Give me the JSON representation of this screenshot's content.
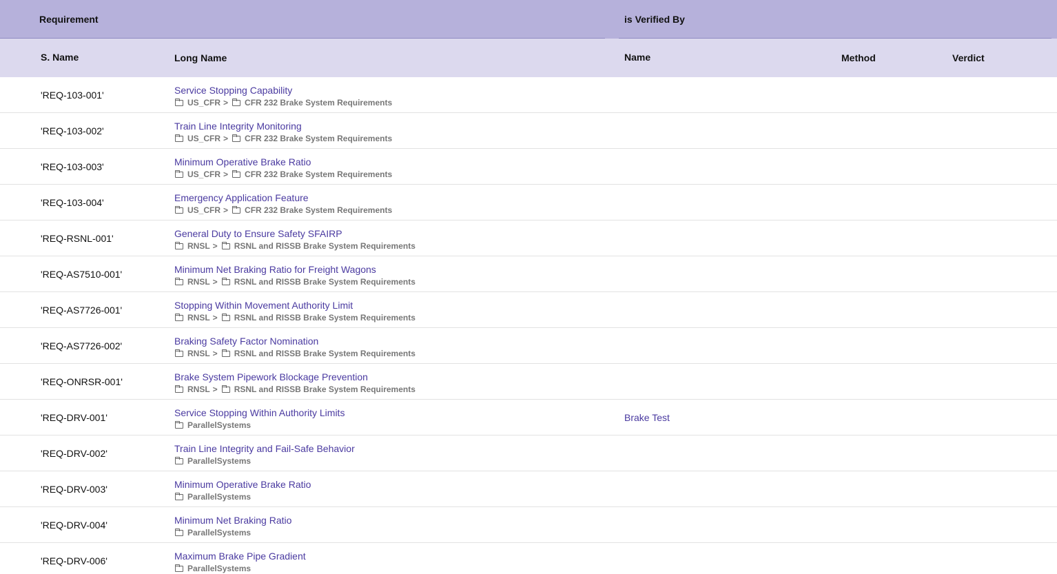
{
  "group_headers": {
    "requirement": "Requirement",
    "verified_by": "is Verified By"
  },
  "columns": {
    "s_name": "S. Name",
    "long_name": "Long Name",
    "name": "Name",
    "method": "Method",
    "verdict": "Verdict"
  },
  "separator": ">",
  "rows": [
    {
      "s_name": "'REQ-103-001'",
      "long_name": "Service Stopping Capability",
      "path": [
        "US_CFR",
        "CFR 232 Brake System Requirements"
      ],
      "verified_by": ""
    },
    {
      "s_name": "'REQ-103-002'",
      "long_name": "Train Line Integrity Monitoring",
      "path": [
        "US_CFR",
        "CFR 232 Brake System Requirements"
      ],
      "verified_by": ""
    },
    {
      "s_name": "'REQ-103-003'",
      "long_name": "Minimum Operative Brake Ratio",
      "path": [
        "US_CFR",
        "CFR 232 Brake System Requirements"
      ],
      "verified_by": ""
    },
    {
      "s_name": "'REQ-103-004'",
      "long_name": "Emergency Application Feature",
      "path": [
        "US_CFR",
        "CFR 232 Brake System Requirements"
      ],
      "verified_by": ""
    },
    {
      "s_name": "'REQ-RSNL-001'",
      "long_name": "General Duty to Ensure Safety SFAIRP",
      "path": [
        "RNSL",
        "RSNL and RISSB Brake System Requirements"
      ],
      "verified_by": ""
    },
    {
      "s_name": "'REQ-AS7510-001'",
      "long_name": "Minimum Net Braking Ratio for Freight Wagons",
      "path": [
        "RNSL",
        "RSNL and RISSB Brake System Requirements"
      ],
      "verified_by": ""
    },
    {
      "s_name": "'REQ-AS7726-001'",
      "long_name": "Stopping Within Movement Authority Limit",
      "path": [
        "RNSL",
        "RSNL and RISSB Brake System Requirements"
      ],
      "verified_by": ""
    },
    {
      "s_name": "'REQ-AS7726-002'",
      "long_name": "Braking Safety Factor Nomination",
      "path": [
        "RNSL",
        "RSNL and RISSB Brake System Requirements"
      ],
      "verified_by": ""
    },
    {
      "s_name": "'REQ-ONRSR-001'",
      "long_name": "Brake System Pipework Blockage Prevention",
      "path": [
        "RNSL",
        "RSNL and RISSB Brake System Requirements"
      ],
      "verified_by": ""
    },
    {
      "s_name": "'REQ-DRV-001'",
      "long_name": "Service Stopping Within Authority Limits",
      "path": [
        "ParallelSystems"
      ],
      "verified_by": "Brake Test"
    },
    {
      "s_name": "'REQ-DRV-002'",
      "long_name": "Train Line Integrity and Fail-Safe Behavior",
      "path": [
        "ParallelSystems"
      ],
      "verified_by": ""
    },
    {
      "s_name": "'REQ-DRV-003'",
      "long_name": "Minimum Operative Brake Ratio",
      "path": [
        "ParallelSystems"
      ],
      "verified_by": ""
    },
    {
      "s_name": "'REQ-DRV-004'",
      "long_name": "Minimum Net Braking Ratio",
      "path": [
        "ParallelSystems"
      ],
      "verified_by": ""
    },
    {
      "s_name": "'REQ-DRV-006'",
      "long_name": "Maximum Brake Pipe Gradient",
      "path": [
        "ParallelSystems"
      ],
      "verified_by": ""
    }
  ]
}
